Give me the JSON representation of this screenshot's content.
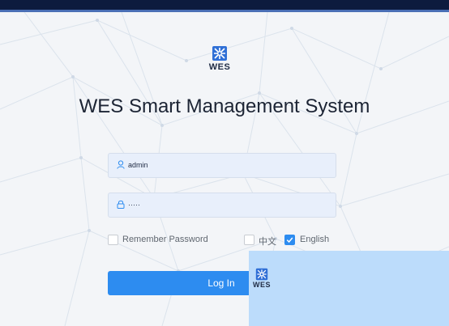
{
  "brand": {
    "name": "WES",
    "title": "WES Smart Management System"
  },
  "login": {
    "username_value": "admin",
    "password_value": "·····",
    "remember_label": "Remember Password",
    "lang_zh_label": "中文",
    "lang_en_label": "English",
    "login_button_label": "Log In"
  },
  "icons": {
    "username": "user-icon",
    "password": "lock-icon",
    "logo": "wes-logo-icon"
  },
  "state": {
    "remember_checked": false,
    "lang_zh_checked": false,
    "lang_en_checked": true
  },
  "colors": {
    "primary": "#2d8cf0",
    "top_bar": "#0d1b3e",
    "input_bg": "#e8effb",
    "overlay": "#bcdcfb"
  }
}
